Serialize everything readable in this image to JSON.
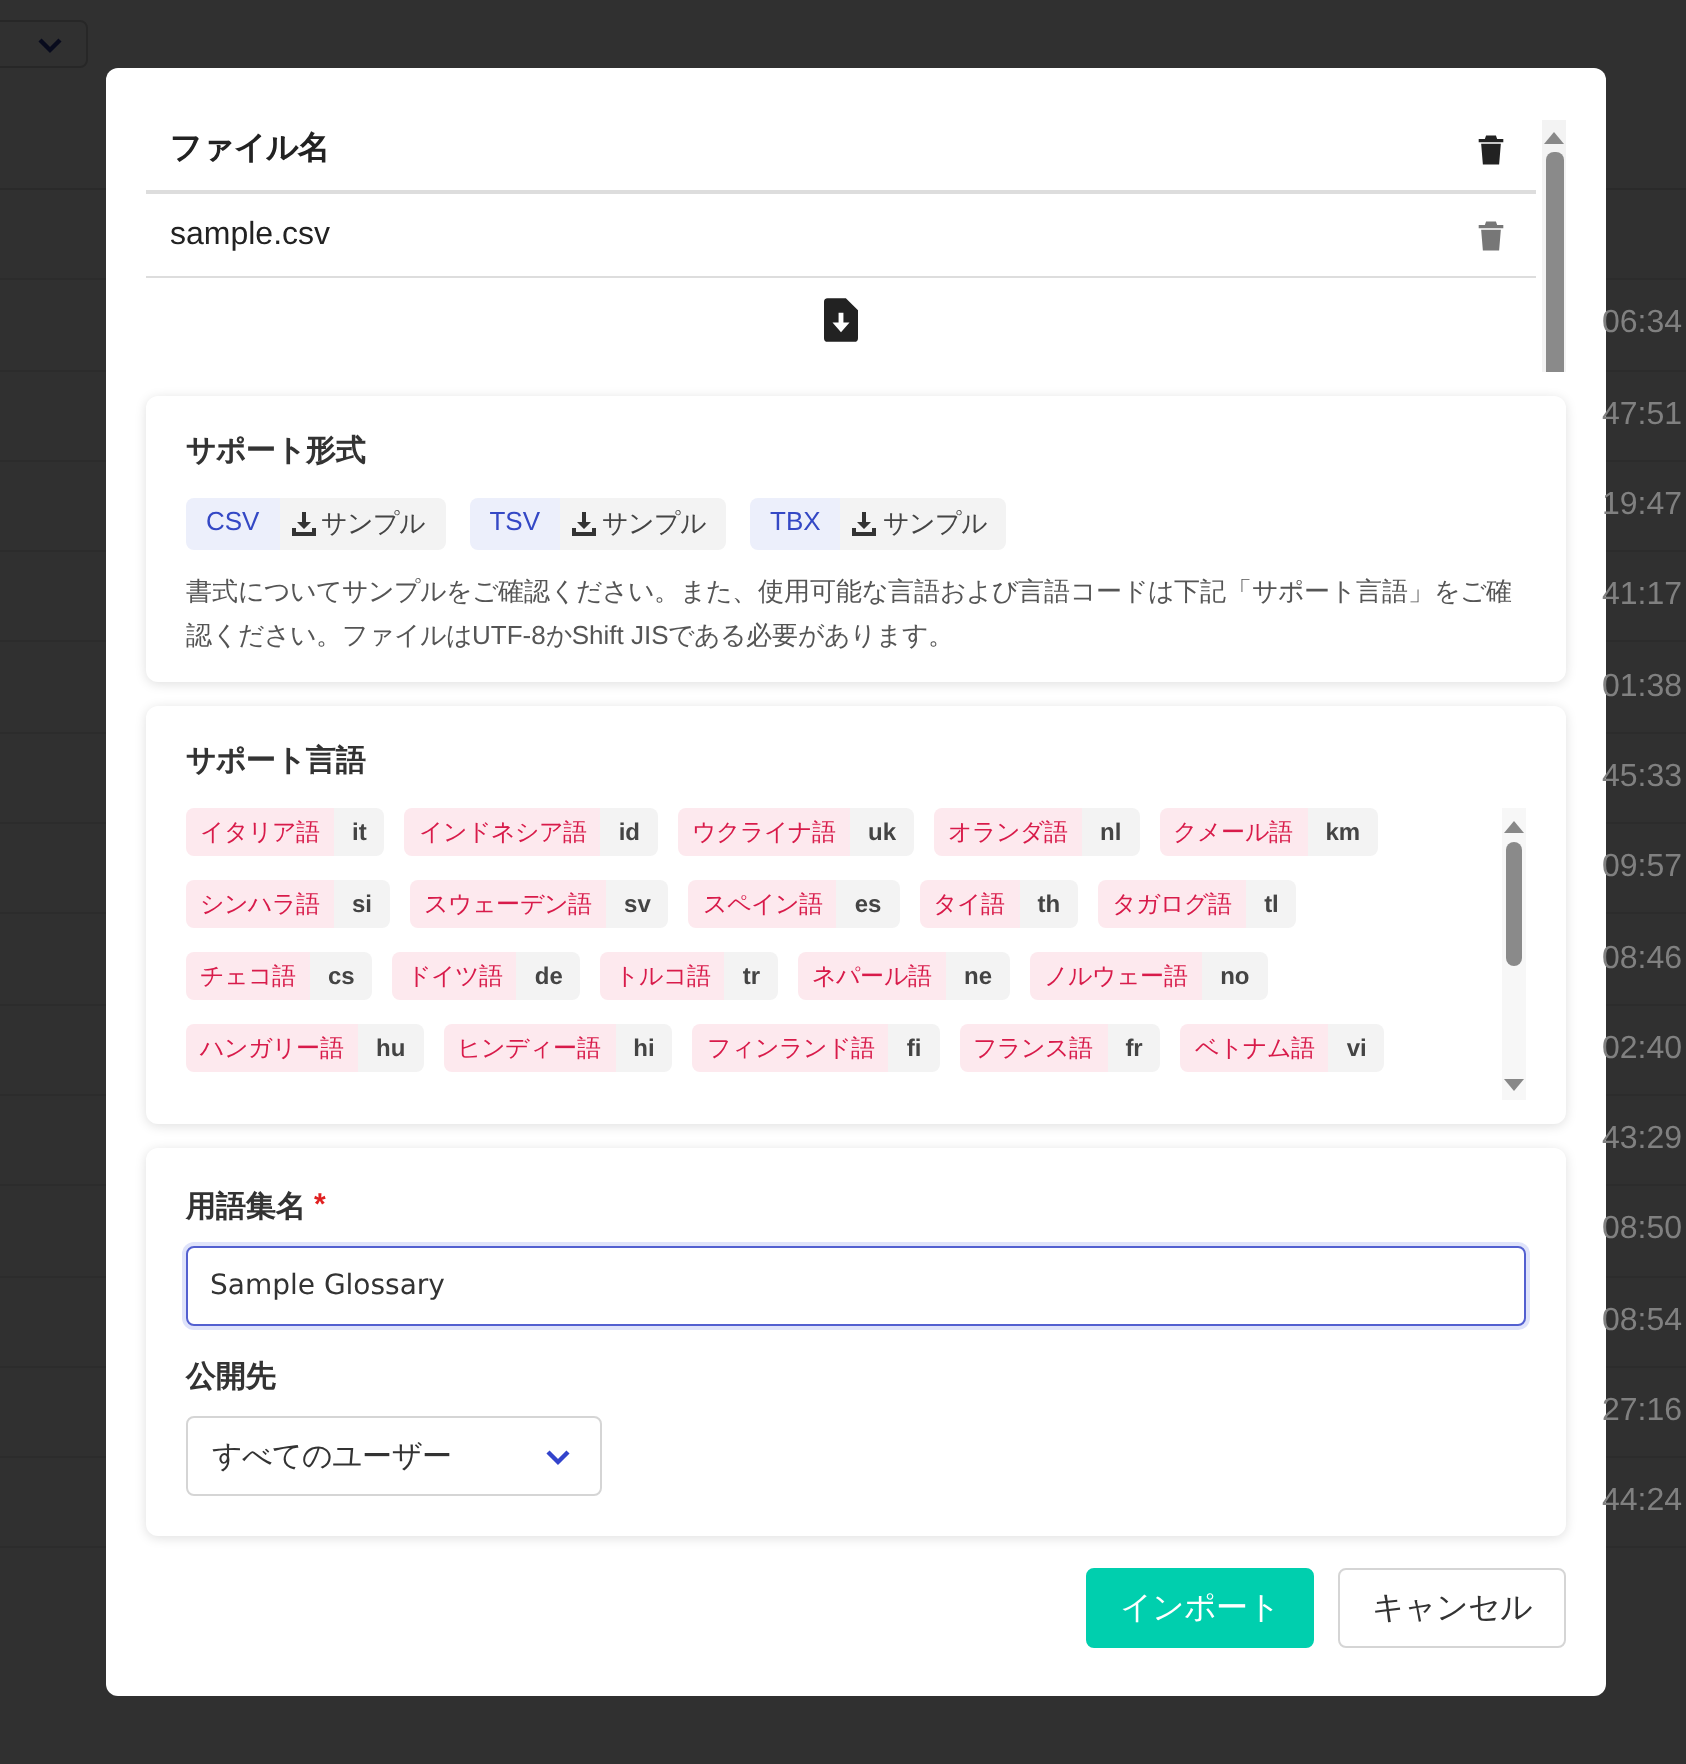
{
  "background": {
    "times": [
      "06:34",
      "47:51",
      "19:47",
      "41:17",
      "01:38",
      "45:33",
      "09:57",
      "08:46",
      "02:40",
      "43:29",
      "08:50",
      "08:54",
      "27:16",
      "44:24"
    ]
  },
  "files": {
    "header": "ファイル名",
    "rows": [
      {
        "name": "sample.csv"
      }
    ]
  },
  "formats": {
    "title": "サポート形式",
    "items": [
      {
        "label": "CSV",
        "sample": "サンプル"
      },
      {
        "label": "TSV",
        "sample": "サンプル"
      },
      {
        "label": "TBX",
        "sample": "サンプル"
      }
    ],
    "note": "書式についてサンプルをご確認ください。また、使用可能な言語および言語コードは下記「サポート言語」をご確認ください。ファイルはUTF-8かShift JISである必要があります。"
  },
  "languages": {
    "title": "サポート言語",
    "items": [
      {
        "name": "イタリア語",
        "code": "it"
      },
      {
        "name": "インドネシア語",
        "code": "id"
      },
      {
        "name": "ウクライナ語",
        "code": "uk"
      },
      {
        "name": "オランダ語",
        "code": "nl"
      },
      {
        "name": "クメール語",
        "code": "km"
      },
      {
        "name": "シンハラ語",
        "code": "si"
      },
      {
        "name": "スウェーデン語",
        "code": "sv"
      },
      {
        "name": "スペイン語",
        "code": "es"
      },
      {
        "name": "タイ語",
        "code": "th"
      },
      {
        "name": "タガログ語",
        "code": "tl"
      },
      {
        "name": "チェコ語",
        "code": "cs"
      },
      {
        "name": "ドイツ語",
        "code": "de"
      },
      {
        "name": "トルコ語",
        "code": "tr"
      },
      {
        "name": "ネパール語",
        "code": "ne"
      },
      {
        "name": "ノルウェー語",
        "code": "no"
      },
      {
        "name": "ハンガリー語",
        "code": "hu"
      },
      {
        "name": "ヒンディー語",
        "code": "hi"
      },
      {
        "name": "フィンランド語",
        "code": "fi"
      },
      {
        "name": "フランス語",
        "code": "fr"
      },
      {
        "name": "ベトナム語",
        "code": "vi"
      }
    ]
  },
  "form": {
    "name_label": "用語集名",
    "required": true,
    "required_mark": "*",
    "name_value": "Sample Glossary",
    "visibility_label": "公開先",
    "visibility_value": "すべてのユーザー"
  },
  "buttons": [
    {
      "label": "インポート",
      "kind": "primary"
    },
    {
      "label": "キャンセル",
      "kind": "secondary"
    }
  ]
}
